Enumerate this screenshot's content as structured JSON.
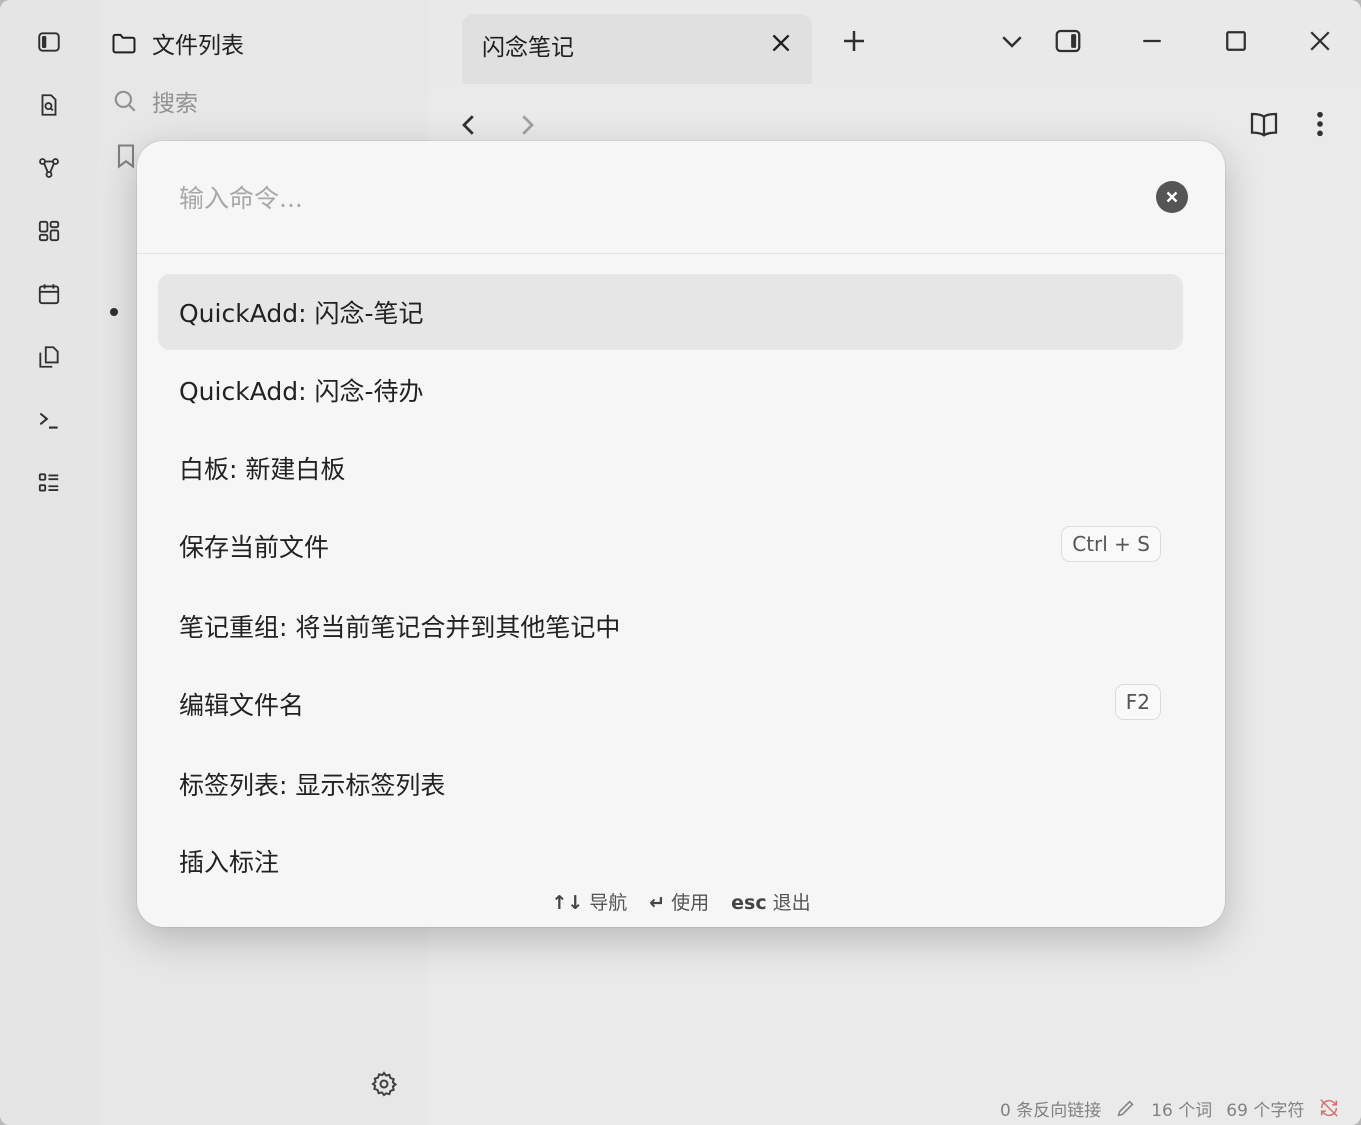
{
  "sidebar": {
    "header_title": "文件列表",
    "search_placeholder": "搜索"
  },
  "tab": {
    "title": "闪念笔记"
  },
  "palette": {
    "placeholder": "输入命令...",
    "commands": [
      {
        "label": "QuickAdd: 闪念-笔记",
        "hotkey": ""
      },
      {
        "label": "QuickAdd: 闪念-待办",
        "hotkey": ""
      },
      {
        "label": "白板: 新建白板",
        "hotkey": ""
      },
      {
        "label": "保存当前文件",
        "hotkey": "Ctrl + S"
      },
      {
        "label": "笔记重组: 将当前笔记合并到其他笔记中",
        "hotkey": ""
      },
      {
        "label": "编辑文件名",
        "hotkey": "F2"
      },
      {
        "label": "标签列表: 显示标签列表",
        "hotkey": ""
      },
      {
        "label": "插入标注",
        "hotkey": ""
      }
    ],
    "footer": {
      "navigate_key": "↑↓",
      "navigate_label": "导航",
      "use_key": "↵",
      "use_label": "使用",
      "esc_key": "esc",
      "esc_label": "退出"
    }
  },
  "status_bar": {
    "backlinks": "0 条反向链接",
    "words": "16 个词",
    "chars": "69 个字符"
  },
  "colors": {
    "selected_row": "#e6e6e6",
    "sync_icon": "#e07a7a"
  }
}
